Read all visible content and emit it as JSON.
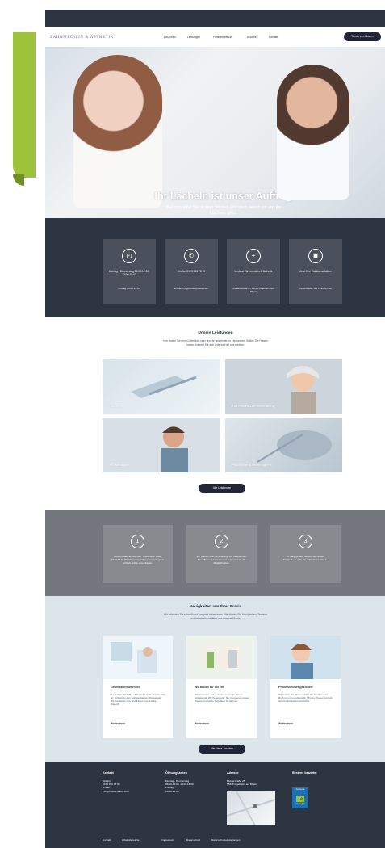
{
  "colors": {
    "green": "#9cc33a",
    "dark": "#2d3442",
    "button": "#202637",
    "grey": "#74777d",
    "news_bg": "#dce5ea"
  },
  "header": {
    "logo": "ZAHNMEDIZIN & ÄSTHETIK",
    "menu": [
      "Das Team",
      "Leistungen",
      "Patientenservice",
      "Aktuelles",
      "Kontakt"
    ],
    "cta": "Termin vereinbaren"
  },
  "hero": {
    "title": "Ihr Lächeln ist unser Auftrag.",
    "subtitle": "Bei uns sind Sie in den besten Händen, wenn es um Ihr Lächeln geht.",
    "down": "⌄"
  },
  "info_cards": [
    {
      "icon": "clock-icon",
      "t1": "Montag - Donnerstag 08:00-12:00, 13:00-18:00",
      "t2": "Freitag 08:00-13:00"
    },
    {
      "icon": "phone-icon",
      "t1": "Telefon 0123 456 78 90",
      "t2": "E-Mail info@musterpraxis.com"
    },
    {
      "icon": "map-pin-icon",
      "t1": "Medical Zahnmedizin & Ästhetik",
      "t2": "Musterstraße 25 55218 Ingelheim am Rhein"
    },
    {
      "icon": "calendar-icon",
      "t1": "Jetzt Ihre Wahlkonsultation",
      "t2": "Vereinbaren Sie Ihren Termin"
    }
  ],
  "services": {
    "title": "Unsere Leistungen",
    "text": "Hier finden Sie einen Überblick über unsere angebotenen Leistungen. Sollten Sie Fragen haben, können Sie sich jederzeit bei uns melden.",
    "tiles": [
      "Chirurgie",
      "Ästhetische Zahnbehandlung",
      "Implantologie",
      "Prophylaxe & Mundhygiene"
    ],
    "button": "Alle Leistungen"
  },
  "steps": [
    {
      "num": "1",
      "text": "Jetzt Kontakt aufnehmen. Telefonisch unter 0123 45 67 89 oder unter Anfrageformular ganz einfach online vereinbaren."
    },
    {
      "num": "2",
      "text": "Wir planen Ihre Behandlung. Wir besprechen Ihren Befund, beraten und zeigen Ihnen die Möglichkeiten."
    },
    {
      "num": "3",
      "text": "Ihr Weg gehen. Nutzen Sie unsere Möglichkeiten für Ihr schönstes Lächeln."
    }
  ],
  "news": {
    "title": "Neuigkeiten aus Ihrer Praxis",
    "text": "Wir möchten Sie schnell und kompakt informieren. Hier finden Sie Neuigkeiten, Termine und Informationsblätter aus unserer Praxis.",
    "cards": [
      {
        "title": "Generationswechsel",
        "body": "Nach über 30 Jahren Tätigkeit verabschiedet sich Dr. Richard in den wohlverdienten Ruhestand. Wir bedanken uns und freuen uns auf die Zukunft.",
        "link": "Weiterlesen"
      },
      {
        "title": "Wir bauen für Sie um",
        "body": "Wir erweitern und renovieren unsere Praxis umfassend. Wir freuen uns, Sie in unseren neuen Räumen in Kürze begrüßen zu können.",
        "link": "Weiterlesen"
      },
      {
        "title": "Praxisschilder gesichert",
        "body": "Wir haben die Praxis mit Dr. Steinmüller und Roth nun neu aufgestellt. Unsere Praxen sind ab sofort barrierefrei erreichbar.",
        "link": "Weiterlesen"
      }
    ],
    "button": "Alle News ansehen"
  },
  "footer": {
    "contact": {
      "head": "Kontakt",
      "lines": [
        "Telefon",
        "0123 456 78 90",
        "E-Mail",
        "info@musterpraxis.com"
      ]
    },
    "hours": {
      "head": "Öffnungszeiten",
      "lines": [
        "Montag - Donnerstag",
        "08:00-12:00, 13:00-18:00",
        "Freitag",
        "08:00-13:00"
      ]
    },
    "address": {
      "head": "Adresse",
      "lines": [
        "Musterstraße 25",
        "55218 Ingelheim am Rhein"
      ]
    },
    "rating": {
      "head": "Bestens bewertet",
      "badge_top": "Jameda",
      "score": "1,0",
      "badge_bottom": "sehr gut"
    },
    "links": [
      "Kontakt",
      "Arbeitsbereiche",
      "Impressum",
      "Datenschutz",
      "Datenschutzeinstellungen"
    ]
  }
}
